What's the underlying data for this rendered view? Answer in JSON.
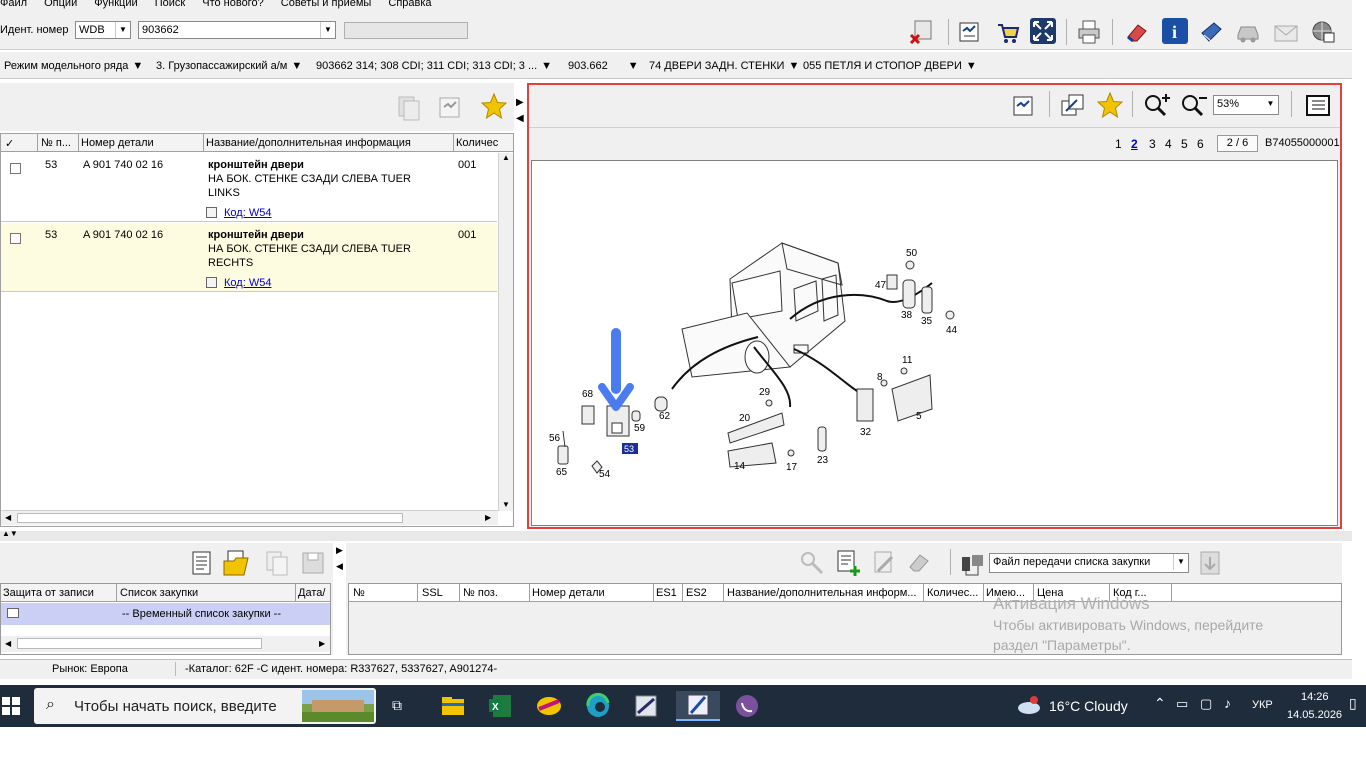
{
  "menu": [
    "Файл",
    "Опции",
    "Функции",
    "Поиск",
    "Что нового?",
    "Советы и приемы",
    "Справка"
  ],
  "ident": {
    "label": "Идент. номер",
    "prefix": "WDB",
    "number": "903662"
  },
  "breadcrumb": {
    "mode": "Режим модельного ряда",
    "class": "3. Грузопассажирский а/м",
    "models": "903662 314; 308 CDI; 311 CDI; 313 CDI; 3 ...",
    "model": "903.662",
    "group": "74 ДВЕРИ ЗАДН. СТЕНКИ",
    "subgroup": "055 ПЕТЛЯ И СТОПОР ДВЕРИ"
  },
  "parts_table": {
    "headers": [
      "✓",
      "№ п...",
      "Номер детали",
      "Название/дополнительная информация",
      "Количес"
    ],
    "rows": [
      {
        "pos": "53",
        "part": "A 901 740 02 16",
        "name": "кронштейн двери",
        "info1": "НА БОК. СТЕНКЕ СЗАДИ СЛЕВА TUER",
        "info2": "LINKS",
        "code": "Код: W54",
        "qty": "001"
      },
      {
        "pos": "53",
        "part": "A 901 740 02 16",
        "name": "кронштейн двери",
        "info1": "НА БОК. СТЕНКЕ СЗАДИ СЛЕВА TUER",
        "info2": "RECHTS",
        "code": "Код: W54",
        "qty": "001"
      }
    ]
  },
  "viewer": {
    "zoom": "53%",
    "pages": [
      "1",
      "2",
      "3",
      "4",
      "5",
      "6"
    ],
    "current_page": "2",
    "page_counter": "2 / 6",
    "image_id": "B74055000001"
  },
  "diagram_labels": [
    "50",
    "47",
    "38",
    "35",
    "44",
    "11",
    "8",
    "5",
    "32",
    "29",
    "20",
    "14",
    "17",
    "23",
    "68",
    "62",
    "59",
    "56",
    "65",
    "54",
    "53"
  ],
  "shopping": {
    "headers": [
      "Защита от записи",
      "Список закупки",
      "Дата/"
    ],
    "row": "-- Временный список закупки --"
  },
  "transfer": {
    "select": "Файл передачи списка закупки",
    "headers": [
      "№",
      "SSL",
      "№ поз.",
      "Номер детали",
      "ES1",
      "ES2",
      "Название/дополнительная информ...",
      "Количес...",
      "Имею...",
      "Цена",
      "Код г..."
    ]
  },
  "activation": {
    "title": "Активация Windows",
    "line1": "Чтобы активировать Windows, перейдите",
    "line2": "раздел \"Параметры\"."
  },
  "status": {
    "market": "Рынок: Европа",
    "catalog": "-Каталог: 62F -С идент. номера: R337627, 5337627, A901274-"
  },
  "taskbar": {
    "search": "Чтобы начать поиск, введите",
    "weather": "16°C  Cloudy",
    "lang": "УКР",
    "time": "14:26",
    "date": "14.05.2026"
  },
  "colors": {
    "accent_border": "#e34040",
    "arrow": "#4a7cf0",
    "taskbar": "#1f2c3c",
    "selected_row": "#fdfbe0"
  }
}
